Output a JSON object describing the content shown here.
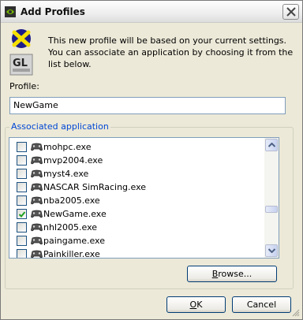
{
  "window": {
    "title": "Add Profiles"
  },
  "icons": {
    "app": "nvidia-logo-icon",
    "close": "close-icon",
    "profile": "gl-icon",
    "gamepad": "gamepad-icon"
  },
  "intro_text": "This new profile will be based on your current settings. You can associate an application by choosing it from the list below.",
  "profile": {
    "label": "Profile:",
    "value": "NewGame"
  },
  "associated": {
    "legend": "Associated application",
    "items": [
      {
        "label": "mohpc.exe",
        "checked": false
      },
      {
        "label": "mvp2004.exe",
        "checked": false
      },
      {
        "label": "myst4.exe",
        "checked": false
      },
      {
        "label": "NASCAR SimRacing.exe",
        "checked": false
      },
      {
        "label": "nba2005.exe",
        "checked": false
      },
      {
        "label": "NewGame.exe",
        "checked": true
      },
      {
        "label": "nhl2005.exe",
        "checked": false
      },
      {
        "label": "paingame.exe",
        "checked": false
      },
      {
        "label": "Painkiller.exe",
        "checked": false
      }
    ]
  },
  "buttons": {
    "browse_first": "B",
    "browse_rest": "rowse...",
    "ok_first": "O",
    "ok_rest": "K",
    "cancel": "Cancel"
  },
  "colors": {
    "legend": "#0046d5",
    "checkmark": "#21a121",
    "window_bg": "#ece9d8"
  }
}
